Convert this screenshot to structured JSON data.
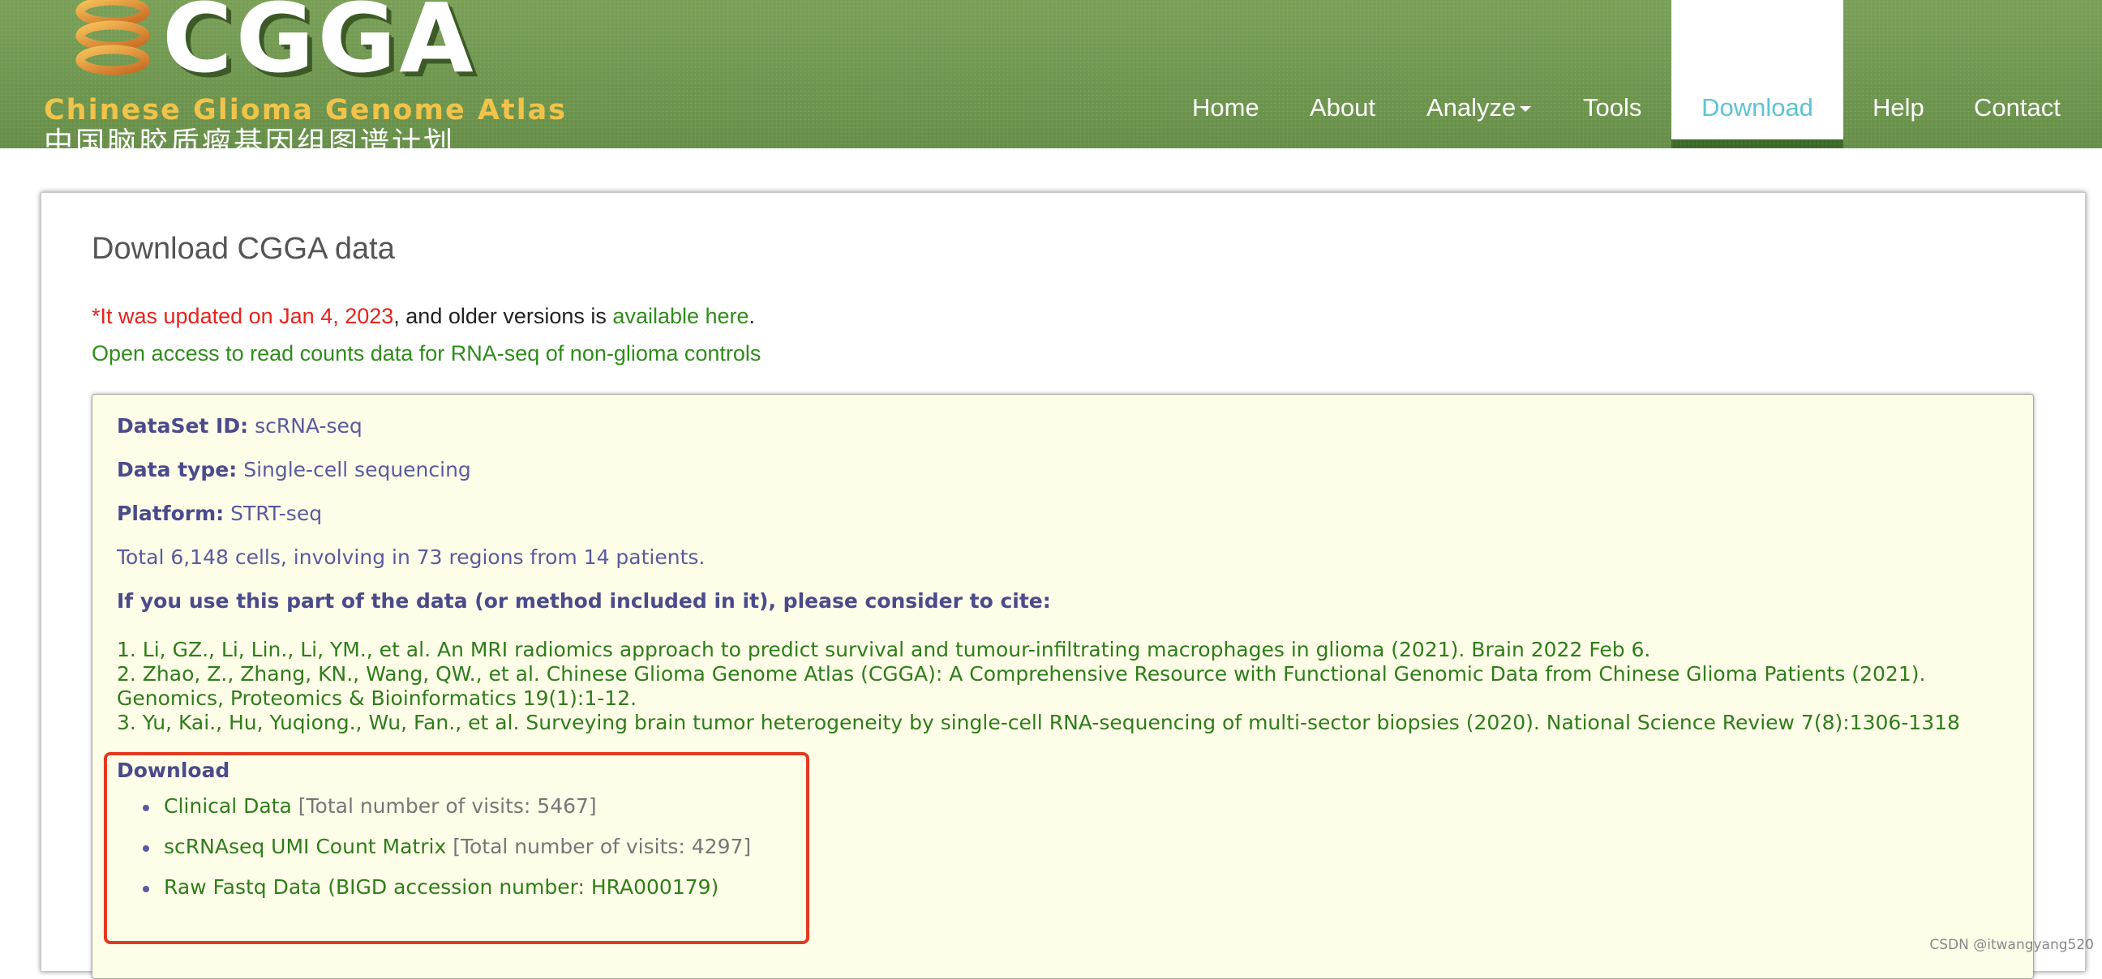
{
  "header": {
    "logo_text": "CGGA",
    "logo_subtitle": "Chinese Glioma Genome Atlas",
    "logo_cn": "中国脑胶质瘤基因组图谱计划",
    "nav": [
      {
        "label": "Home"
      },
      {
        "label": "About"
      },
      {
        "label": "Analyze"
      },
      {
        "label": "Tools"
      },
      {
        "label": "Download",
        "active": true
      },
      {
        "label": "Help"
      },
      {
        "label": "Contact"
      }
    ]
  },
  "main": {
    "title": "Download CGGA data",
    "update_red": "*It was updated on Jan 4, 2023",
    "update_mid": ", and older versions is ",
    "update_link": "available here",
    "update_end": ".",
    "access_link": "Open access to read counts data for RNA-seq of non-glioma controls"
  },
  "dataset": {
    "id_label": "DataSet ID:",
    "id_value": "scRNA-seq",
    "type_label": "Data type:",
    "type_value": "Single-cell sequencing",
    "platform_label": "Platform:",
    "platform_value": "STRT-seq",
    "summary": "Total 6,148 cells, involving in 73 regions from 14 patients.",
    "cite_heading": "If you use this part of the data (or method included in it), please consider to cite:",
    "refs": [
      "1. Li, GZ., Li, Lin., Li, YM., et al. An MRI radiomics approach to predict survival and tumour-infiltrating macrophages in glioma (2021). Brain 2022 Feb 6.",
      "2. Zhao, Z., Zhang, KN., Wang, QW., et al. Chinese Glioma Genome Atlas (CGGA): A Comprehensive Resource with Functional Genomic Data from Chinese Glioma Patients (2021). Genomics, Proteomics & Bioinformatics 19(1):1-12.",
      "3. Yu, Kai., Hu, Yuqiong., Wu, Fan., et al. Surveying brain tumor heterogeneity by single-cell RNA-sequencing of multi-sector biopsies (2020). National Science Review 7(8):1306-1318"
    ]
  },
  "download": {
    "title": "Download",
    "items": [
      {
        "label": "Clinical Data",
        "note": " [Total number of visits: 5467]"
      },
      {
        "label": "scRNAseq UMI Count Matrix",
        "note": " [Total number of visits: 4297]"
      },
      {
        "label": "Raw Fastq Data (BIGD accession number: HRA000179)",
        "note": ""
      }
    ]
  },
  "watermark": "CSDN @itwangyang520",
  "colors": {
    "header_green": "#6f9750",
    "nav_active_text": "#5bc3d0",
    "link_green": "#2f8d1a",
    "update_red": "#e8231b",
    "dataset_bg": "#fdfde8",
    "label_purple": "#4a4a8c",
    "highlight_box": "#e23a22"
  }
}
